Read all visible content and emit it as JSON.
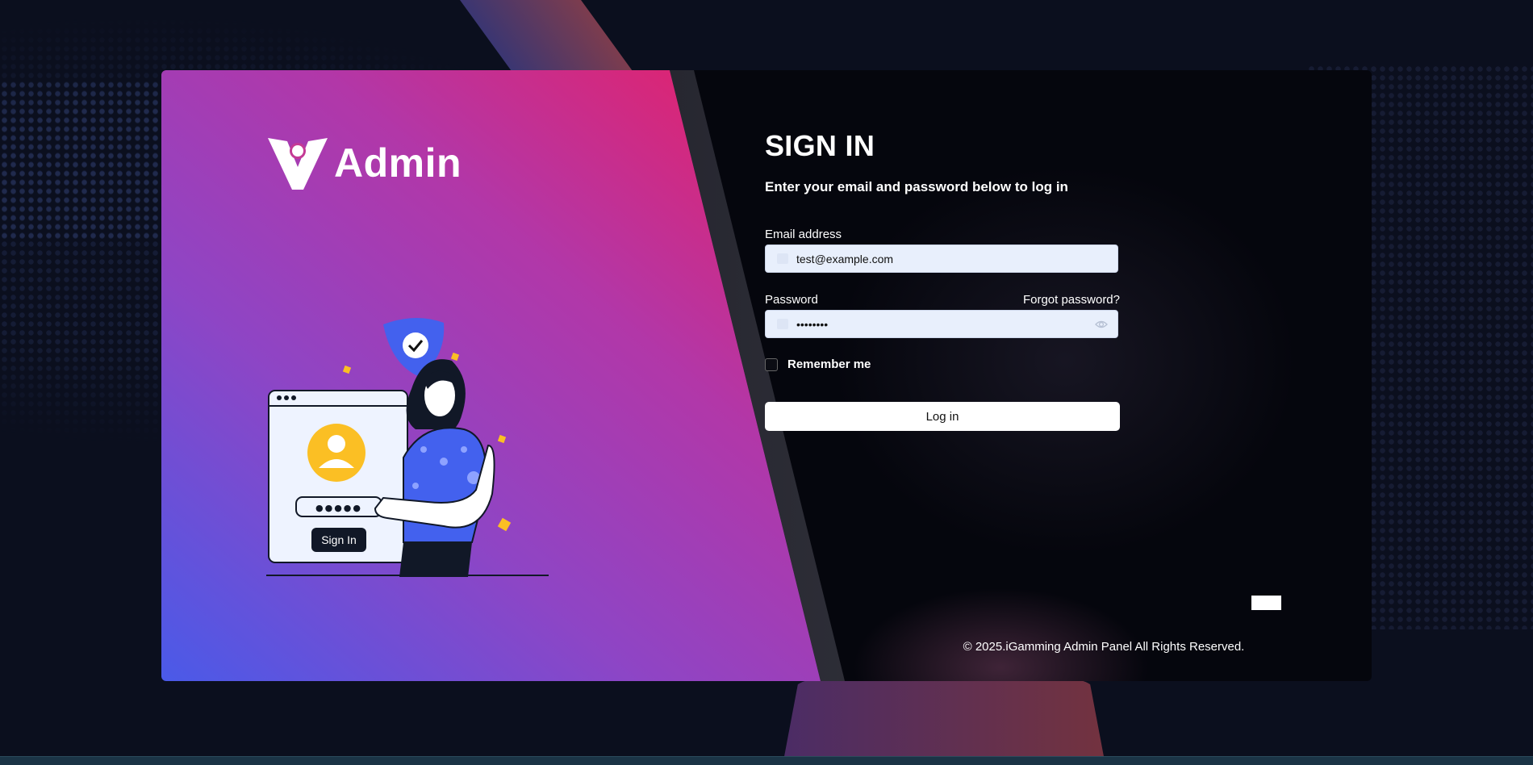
{
  "brand": {
    "name": "Admin"
  },
  "illustration": {
    "button_label": "Sign In",
    "password_mask": "●●●●●"
  },
  "form": {
    "title": "SIGN IN",
    "subtitle": "Enter your email and password below to log in",
    "email": {
      "label": "Email address",
      "value": "test@example.com",
      "icon": "mail-icon"
    },
    "password": {
      "label": "Password",
      "value": "password",
      "forgot_label": "Forgot password?",
      "icon": "lock-icon",
      "toggle_icon": "eye-icon"
    },
    "remember": {
      "label": "Remember me",
      "checked": false
    },
    "submit_label": "Log in"
  },
  "footer": {
    "copyright": "© 2025.iGamming Admin Panel All Rights Reserved."
  },
  "colors": {
    "background": "#0b0f1e",
    "panel_gradient_start": "#4a5ae8",
    "panel_gradient_end": "#f7195a",
    "field_bg": "#e8effc",
    "button_bg": "#ffffff",
    "accent_yellow": "#fbbf24",
    "accent_blue": "#4361ee"
  }
}
